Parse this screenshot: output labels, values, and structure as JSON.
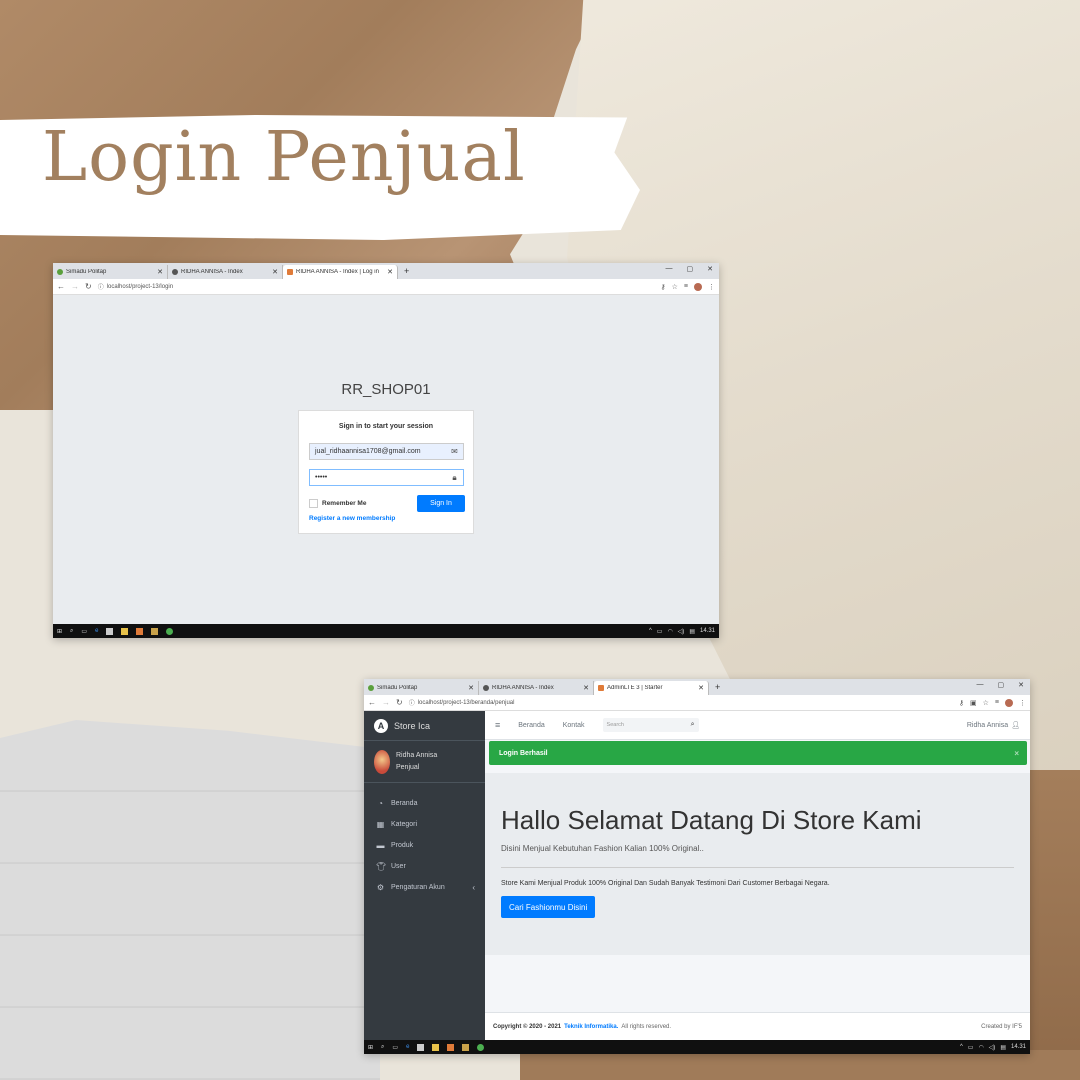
{
  "title": "Login Penjual",
  "login_window": {
    "tabs": [
      {
        "label": "Simadu Politap",
        "color": "#5aa03c"
      },
      {
        "label": "RIDHA ANNISA - Index",
        "color": "#555555"
      },
      {
        "label": "RIDHA ANNISA - Index | Log in",
        "color": "#e07b39"
      }
    ],
    "url": "localhost/project-13/login",
    "page": {
      "logo": "RR_SHOP01",
      "message": "Sign in to start your session",
      "email_value": "jual_ridhaannisa1708@gmail.com",
      "password_value": "•••••",
      "remember_label": "Remember Me",
      "signin_label": "Sign In",
      "register_link": "Register a new membership"
    },
    "clock": "14.31"
  },
  "admin_window": {
    "tabs": [
      {
        "label": "Simadu Politap",
        "color": "#5aa03c"
      },
      {
        "label": "RIDHA ANNISA - Index",
        "color": "#555555"
      },
      {
        "label": "AdminLTE 3 | Starter",
        "color": "#e07b39"
      }
    ],
    "url": "localhost/project-13/beranda/penjual",
    "sidebar": {
      "brand": "Store Ica",
      "user_name": "Ridha Annisa",
      "user_role": "Penjual",
      "items": [
        {
          "label": "Beranda",
          "icon": "tachometer-icon"
        },
        {
          "label": "Kategori",
          "icon": "grid-icon"
        },
        {
          "label": "Produk",
          "icon": "archive-icon"
        },
        {
          "label": "User",
          "icon": "shirt-icon"
        },
        {
          "label": "Pengaturan Akun",
          "icon": "gear-icon"
        }
      ]
    },
    "topnav": {
      "links": [
        "Beranda",
        "Kontak"
      ],
      "search_placeholder": "Search",
      "user": "Ridha Annisa"
    },
    "alert": "Login Berhasil",
    "jumbotron": {
      "title": "Hallo Selamat Datang Di Store Kami",
      "lead": "Disini Menjual Kebutuhan Fashion Kalian 100% Original..",
      "text": "Store Kami Menjual Produk 100% Original Dan Sudah Banyak Testimoni Dari Customer Berbagai Negara.",
      "button": "Cari Fashionmu Disini"
    },
    "footer": {
      "copyright": "Copyright © 2020 - 2021",
      "org": "Teknik Informatika.",
      "rights": "All rights reserved.",
      "credit": "Created by IF'5"
    },
    "clock": "14.31"
  }
}
